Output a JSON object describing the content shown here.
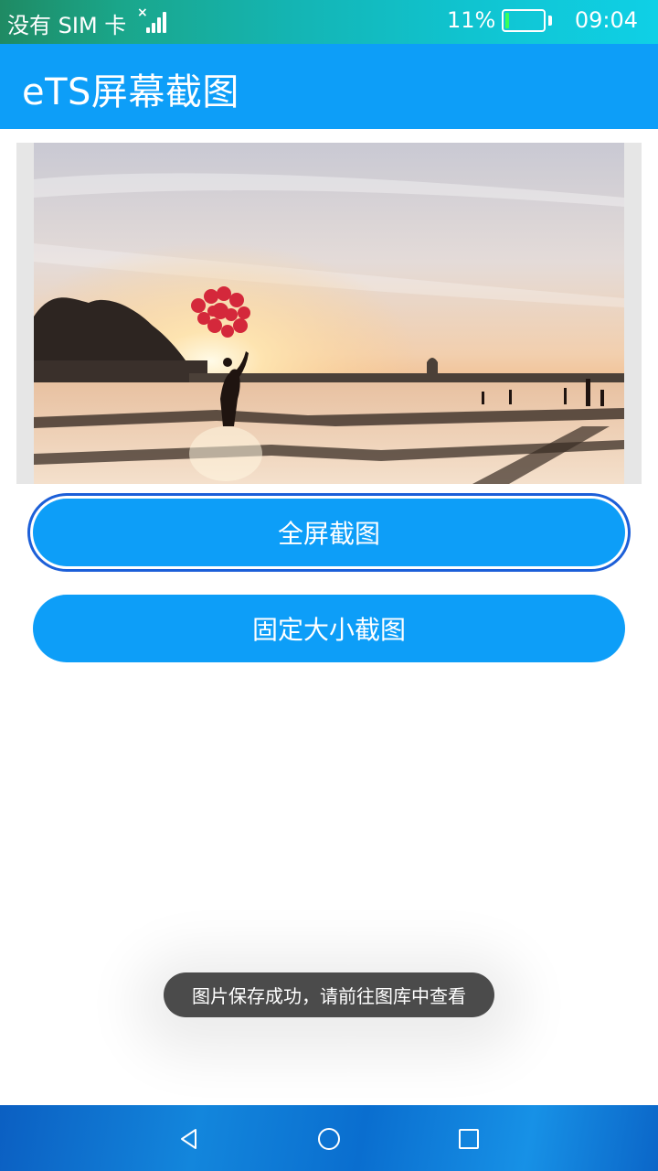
{
  "status_bar": {
    "carrier": "没有 SIM 卡",
    "battery_percent": "11%",
    "battery_level": 0.11,
    "time": "09:04",
    "icons": [
      "no-sim-signal-icon",
      "battery-icon"
    ]
  },
  "app_bar": {
    "title": "eTS屏幕截图"
  },
  "main": {
    "image": "sunset-balloons-photo",
    "buttons": {
      "fullscreen": "全屏截图",
      "fixed_size": "固定大小截图"
    }
  },
  "toast": {
    "message": "图片保存成功，请前往图库中查看"
  },
  "nav_bar": {
    "icons": [
      "back-triangle-icon",
      "home-circle-icon",
      "recent-square-icon"
    ]
  },
  "colors": {
    "accent": "#0d9ef8",
    "focus_ring": "#1c5fd8",
    "toast_bg": "#4b4b4b"
  }
}
